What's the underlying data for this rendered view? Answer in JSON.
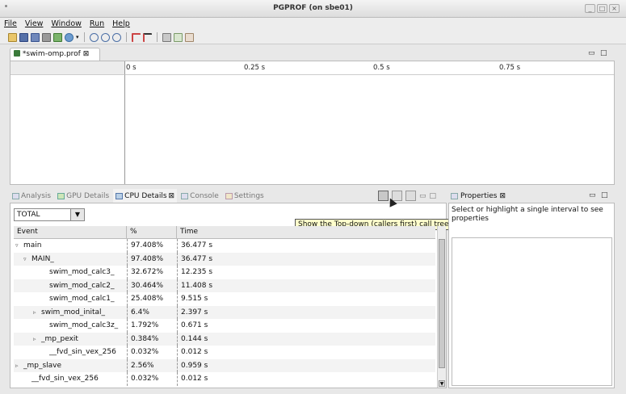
{
  "window": {
    "title": "PGPROF  (on sbe01)",
    "controls": [
      "_",
      "□",
      "×"
    ]
  },
  "menu": [
    "File",
    "View",
    "Window",
    "Run",
    "Help"
  ],
  "toolbar_icons": [
    "new-session-icon",
    "save-icon",
    "save-as-icon",
    "print-icon",
    "export-icon",
    "connect-icon",
    "dropdown-icon",
    "zoom-in-icon",
    "zoom-out-icon",
    "zoom-fit-icon",
    "filter-icon",
    "filter-clear-icon",
    "view-mode-1-icon",
    "view-mode-2-icon",
    "view-mode-3-icon"
  ],
  "editor": {
    "tab_label": "*swim-omp.prof",
    "close_glyph": "⊠",
    "minimize": "▭",
    "maximize": "□"
  },
  "timeline": {
    "ticks": [
      "0 s",
      "0.25 s",
      "0.5 s",
      "0.75 s"
    ]
  },
  "bottom_tabs": [
    {
      "label": "Analysis",
      "active": false
    },
    {
      "label": "GPU Details",
      "active": false
    },
    {
      "label": "CPU Details",
      "active": true
    },
    {
      "label": "Console",
      "active": false
    },
    {
      "label": "Settings",
      "active": false
    }
  ],
  "combo": {
    "value": "TOTAL",
    "arrow": "▼"
  },
  "tooltip": "Show the Top-down (callers first) call tree view",
  "table": {
    "headers": [
      "Event",
      "%",
      "Time"
    ],
    "rows": [
      {
        "event": "main",
        "pct": "97.408%",
        "time": "36.477 s",
        "indent": 0,
        "expander": "▿"
      },
      {
        "event": "MAIN_",
        "pct": "97.408%",
        "time": "36.477 s",
        "indent": 1,
        "expander": "▿"
      },
      {
        "event": "swim_mod_calc3_",
        "pct": "32.672%",
        "time": "12.235 s",
        "indent": 2,
        "expander": ""
      },
      {
        "event": "swim_mod_calc2_",
        "pct": "30.464%",
        "time": "11.408 s",
        "indent": 2,
        "expander": ""
      },
      {
        "event": "swim_mod_calc1_",
        "pct": "25.408%",
        "time": "9.515 s",
        "indent": 2,
        "expander": ""
      },
      {
        "event": "swim_mod_inital_",
        "pct": "6.4%",
        "time": "2.397 s",
        "indent": 2,
        "expander": "▹"
      },
      {
        "event": "swim_mod_calc3z_",
        "pct": "1.792%",
        "time": "0.671 s",
        "indent": 2,
        "expander": ""
      },
      {
        "event": "_mp_pexit",
        "pct": "0.384%",
        "time": "0.144 s",
        "indent": 2,
        "expander": "▹"
      },
      {
        "event": "__fvd_sin_vex_256",
        "pct": "0.032%",
        "time": "0.012 s",
        "indent": 2,
        "expander": ""
      },
      {
        "event": "_mp_slave",
        "pct": "2.56%",
        "time": "0.959 s",
        "indent": 0,
        "expander": "▹"
      },
      {
        "event": "__fvd_sin_vex_256",
        "pct": "0.032%",
        "time": "0.012 s",
        "indent": 0,
        "expander": ""
      }
    ]
  },
  "properties": {
    "tab_label": "Properties",
    "close_glyph": "⊠",
    "message": "Select or highlight a single interval to see properties"
  },
  "colors": {
    "selected_tab": "#f2f2f2",
    "tooltip_bg": "#ffffcc"
  }
}
